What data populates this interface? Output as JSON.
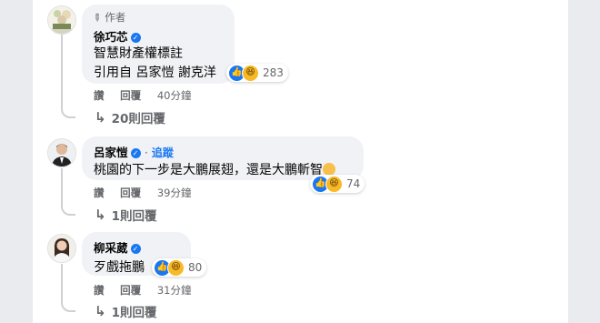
{
  "comments": [
    {
      "author_tag": "作者",
      "name": "徐巧芯",
      "verified": true,
      "lines": [
        "智慧財產權標註",
        "引用自 呂家愷 謝克洋"
      ],
      "reaction_count": "283",
      "actions": [
        "讚",
        "回覆",
        "40分鐘"
      ],
      "replies": "20則回覆"
    },
    {
      "name": "呂家愷",
      "verified": true,
      "follow": "追蹤",
      "lines": [
        "桃園的下一步是大鵬展翅，還是大鵬斬智"
      ],
      "reaction_count": "74",
      "actions": [
        "讚",
        "回覆",
        "39分鐘"
      ],
      "replies": "1則回覆"
    },
    {
      "name": "柳采葳",
      "verified": true,
      "lines": [
        "歹戲拖鵬"
      ],
      "reaction_count": "80",
      "actions": [
        "讚",
        "回覆",
        "31分鐘"
      ],
      "replies": "1則回覆"
    }
  ],
  "icons": {
    "author": "pencil-icon",
    "verified": "verified-badge-icon",
    "like": "like-reaction-icon",
    "haha": "haha-reaction-icon",
    "reply_arrow": "reply-arrow-icon",
    "thinking": "thinking-face-emoji"
  },
  "colors": {
    "accent": "#1877f2",
    "bubble": "#f0f2f5",
    "muted": "#65676b"
  }
}
